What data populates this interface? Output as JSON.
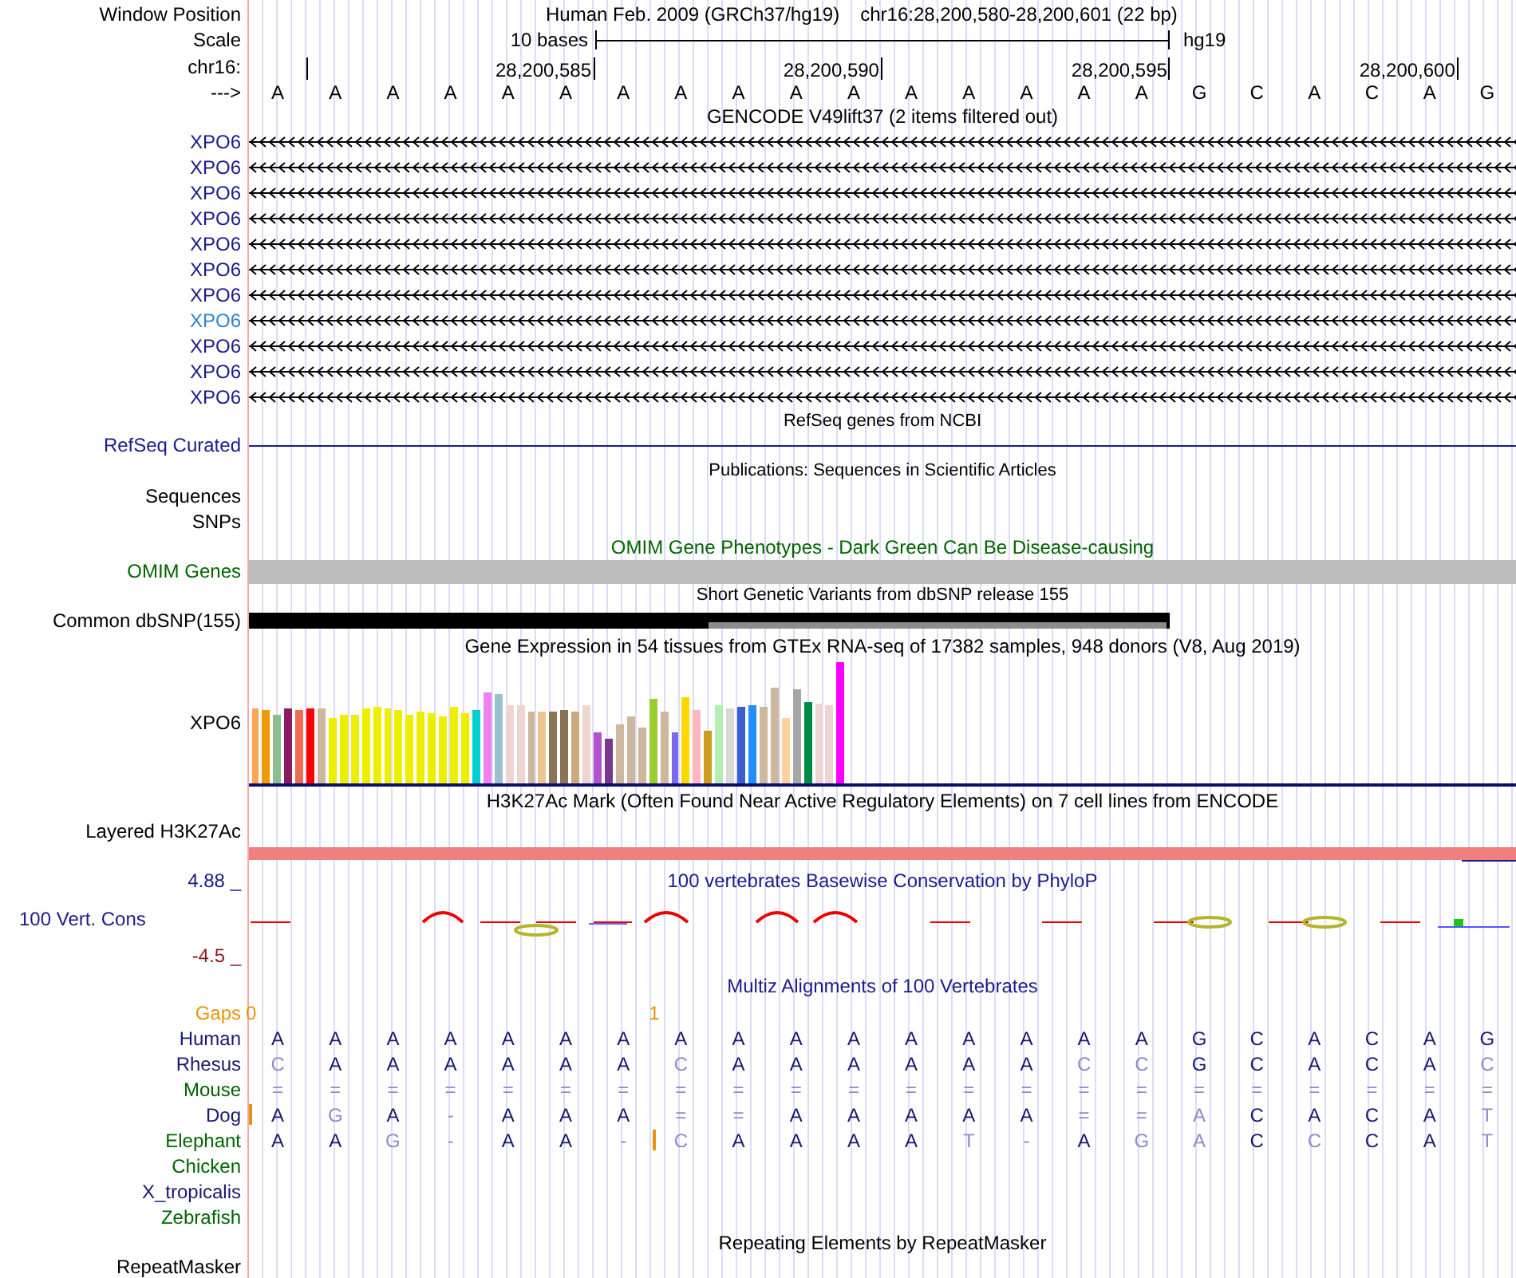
{
  "header": {
    "window_position_label": "Window Position",
    "assembly": "Human Feb. 2009 (GRCh37/hg19)",
    "position": "chr16:28,200,580-28,200,601 (22 bp)",
    "scale_label": "Scale",
    "scale_text": "10 bases",
    "scale_db": "hg19",
    "chrom_label": "chr16:",
    "ticks": [
      "28,200,585",
      "28,200,590",
      "28,200,595",
      "28,200,600"
    ],
    "strand_label": "--->",
    "bases": [
      "A",
      "A",
      "A",
      "A",
      "A",
      "A",
      "A",
      "A",
      "A",
      "A",
      "A",
      "A",
      "A",
      "A",
      "A",
      "A",
      "G",
      "C",
      "A",
      "C",
      "A",
      "G"
    ]
  },
  "tracks": [
    {
      "kind": "gencode",
      "title": "GENCODE V49lift37 (2 items filtered out)",
      "items": [
        {
          "name": "XPO6",
          "selected": false
        },
        {
          "name": "XPO6",
          "selected": false
        },
        {
          "name": "XPO6",
          "selected": false
        },
        {
          "name": "XPO6",
          "selected": false
        },
        {
          "name": "XPO6",
          "selected": false
        },
        {
          "name": "XPO6",
          "selected": false
        },
        {
          "name": "XPO6",
          "selected": false
        },
        {
          "name": "XPO6",
          "selected": true
        },
        {
          "name": "XPO6",
          "selected": false
        },
        {
          "name": "XPO6",
          "selected": false
        },
        {
          "name": "XPO6",
          "selected": false
        }
      ]
    },
    {
      "kind": "refseq",
      "title": "RefSeq genes from NCBI",
      "label": "RefSeq Curated"
    },
    {
      "kind": "empty",
      "title": "Publications: Sequences in Scientific Articles",
      "labels": [
        "Sequences",
        "SNPs"
      ]
    },
    {
      "kind": "omim",
      "title": "OMIM Gene Phenotypes - Dark Green Can Be Disease-causing",
      "label": "OMIM Genes"
    },
    {
      "kind": "dbsnp",
      "title": "Short Genetic Variants from dbSNP release 155",
      "label": "Common dbSNP(155)"
    },
    {
      "kind": "gtex",
      "title": "Gene Expression in 54 tissues from GTEx RNA-seq of 17382 samples, 948 donors (V8, Aug 2019)",
      "label": "XPO6",
      "bars": [
        {
          "color": "#ffa54f"
        },
        {
          "color": "#ee9a00"
        },
        {
          "color": "#8fbc8f"
        },
        {
          "color": "#8b1c62"
        },
        {
          "color": "#ee6a50"
        },
        {
          "color": "#ff0000"
        },
        {
          "color": "#cdb79e"
        },
        {
          "color": "#eeee00"
        },
        {
          "color": "#eeee00"
        },
        {
          "color": "#eeee00"
        },
        {
          "color": "#eeee00"
        },
        {
          "color": "#eeee00"
        },
        {
          "color": "#eeee00"
        },
        {
          "color": "#eeee00"
        },
        {
          "color": "#eeee00"
        },
        {
          "color": "#eeee00"
        },
        {
          "color": "#eeee00"
        },
        {
          "color": "#eeee00"
        },
        {
          "color": "#eeee00"
        },
        {
          "color": "#eeee00"
        },
        {
          "color": "#00ced1"
        },
        {
          "color": "#ee82ee"
        },
        {
          "color": "#9ac0cd"
        },
        {
          "color": "#eed5d2"
        },
        {
          "color": "#eed5d2"
        },
        {
          "color": "#cdb79e"
        },
        {
          "color": "#eec591"
        },
        {
          "color": "#8b7355"
        },
        {
          "color": "#8b7355"
        },
        {
          "color": "#cdaa7d"
        },
        {
          "color": "#eed5d2"
        },
        {
          "color": "#b452cd"
        },
        {
          "color": "#7a378b"
        },
        {
          "color": "#cdb79e"
        },
        {
          "color": "#cdb79e"
        },
        {
          "color": "#cdb79e"
        },
        {
          "color": "#9acd32"
        },
        {
          "color": "#cdb79e"
        },
        {
          "color": "#7b68ee"
        },
        {
          "color": "#ffd700"
        },
        {
          "color": "#ffb6c1"
        },
        {
          "color": "#cd9b1d"
        },
        {
          "color": "#b4eeb4"
        },
        {
          "color": "#d9d9d9"
        },
        {
          "color": "#3a5fcd"
        },
        {
          "color": "#1e90ff"
        },
        {
          "color": "#cdb79e"
        },
        {
          "color": "#cdb79e"
        },
        {
          "color": "#ffd39b"
        },
        {
          "color": "#a6a6a6"
        },
        {
          "color": "#008b45"
        },
        {
          "color": "#eed5d2"
        },
        {
          "color": "#eed5d2"
        },
        {
          "color": "#ff00ff"
        }
      ]
    },
    {
      "kind": "h3k27ac",
      "title": "H3K27Ac Mark (Often Found Near Active Regulatory Elements) on 7 cell lines from ENCODE",
      "label": "Layered H3K27Ac"
    },
    {
      "kind": "phylop",
      "title": "100 vertebrates Basewise Conservation by PhyloP",
      "label": "100 Vert. Cons",
      "axis_max": "4.88 _",
      "axis_min": "-4.5 _"
    },
    {
      "kind": "multiz",
      "title": "Multiz Alignments of 100 Vertebrates",
      "gaps": {
        "label": "Gaps",
        "marks": [
          "0",
          "1"
        ]
      },
      "species": [
        {
          "name": "Human",
          "color": "#191970",
          "bases": [
            {
              "b": "A",
              "match": true
            },
            {
              "b": "A",
              "match": true
            },
            {
              "b": "A",
              "match": true
            },
            {
              "b": "A",
              "match": true
            },
            {
              "b": "A",
              "match": true
            },
            {
              "b": "A",
              "match": true
            },
            {
              "b": "A",
              "match": true
            },
            {
              "b": "A",
              "match": true
            },
            {
              "b": "A",
              "match": true
            },
            {
              "b": "A",
              "match": true
            },
            {
              "b": "A",
              "match": true
            },
            {
              "b": "A",
              "match": true
            },
            {
              "b": "A",
              "match": true
            },
            {
              "b": "A",
              "match": true
            },
            {
              "b": "A",
              "match": true
            },
            {
              "b": "A",
              "match": true
            },
            {
              "b": "G",
              "match": true
            },
            {
              "b": "C",
              "match": true
            },
            {
              "b": "A",
              "match": true
            },
            {
              "b": "C",
              "match": true
            },
            {
              "b": "A",
              "match": true
            },
            {
              "b": "G",
              "match": true
            }
          ]
        },
        {
          "name": "Rhesus",
          "color": "#191970",
          "bases": [
            {
              "b": "C",
              "match": false
            },
            {
              "b": "A",
              "match": true
            },
            {
              "b": "A",
              "match": true
            },
            {
              "b": "A",
              "match": true
            },
            {
              "b": "A",
              "match": true
            },
            {
              "b": "A",
              "match": true
            },
            {
              "b": "A",
              "match": true
            },
            {
              "b": "C",
              "match": false
            },
            {
              "b": "A",
              "match": true
            },
            {
              "b": "A",
              "match": true
            },
            {
              "b": "A",
              "match": true
            },
            {
              "b": "A",
              "match": true
            },
            {
              "b": "A",
              "match": true
            },
            {
              "b": "A",
              "match": true
            },
            {
              "b": "C",
              "match": false
            },
            {
              "b": "C",
              "match": false
            },
            {
              "b": "G",
              "match": true
            },
            {
              "b": "C",
              "match": true
            },
            {
              "b": "A",
              "match": true
            },
            {
              "b": "C",
              "match": true
            },
            {
              "b": "A",
              "match": true
            },
            {
              "b": "C",
              "match": false
            }
          ]
        },
        {
          "name": "Mouse",
          "color": "#006400",
          "bases": [
            {
              "b": "=",
              "match": false
            },
            {
              "b": "=",
              "match": false
            },
            {
              "b": "=",
              "match": false
            },
            {
              "b": "=",
              "match": false
            },
            {
              "b": "=",
              "match": false
            },
            {
              "b": "=",
              "match": false
            },
            {
              "b": "=",
              "match": false
            },
            {
              "b": "=",
              "match": false
            },
            {
              "b": "=",
              "match": false
            },
            {
              "b": "=",
              "match": false
            },
            {
              "b": "=",
              "match": false
            },
            {
              "b": "=",
              "match": false
            },
            {
              "b": "=",
              "match": false
            },
            {
              "b": "=",
              "match": false
            },
            {
              "b": "=",
              "match": false
            },
            {
              "b": "=",
              "match": false
            },
            {
              "b": "=",
              "match": false
            },
            {
              "b": "=",
              "match": false
            },
            {
              "b": "=",
              "match": false
            },
            {
              "b": "=",
              "match": false
            },
            {
              "b": "=",
              "match": false
            },
            {
              "b": "=",
              "match": false
            }
          ]
        },
        {
          "name": "Dog",
          "color": "#191970",
          "bases": [
            {
              "b": "A",
              "match": true,
              "insertion": true
            },
            {
              "b": "G",
              "match": false,
              "insertion": false
            },
            {
              "b": "A",
              "match": true,
              "insertion": false
            },
            {
              "b": "-",
              "match": false,
              "insertion": false
            },
            {
              "b": "A",
              "match": true,
              "insertion": false
            },
            {
              "b": "A",
              "match": true,
              "insertion": false
            },
            {
              "b": "A",
              "match": true,
              "insertion": false
            },
            {
              "b": "=",
              "match": false,
              "insertion": false
            },
            {
              "b": "=",
              "match": false,
              "insertion": false
            },
            {
              "b": "A",
              "match": true,
              "insertion": false
            },
            {
              "b": "A",
              "match": true,
              "insertion": false
            },
            {
              "b": "A",
              "match": true,
              "insertion": false
            },
            {
              "b": "A",
              "match": true,
              "insertion": false
            },
            {
              "b": "A",
              "match": true,
              "insertion": false
            },
            {
              "b": "=",
              "match": false,
              "insertion": false
            },
            {
              "b": "=",
              "match": false,
              "insertion": false
            },
            {
              "b": "A",
              "match": false,
              "insertion": false
            },
            {
              "b": "C",
              "match": true,
              "insertion": false
            },
            {
              "b": "A",
              "match": true,
              "insertion": false
            },
            {
              "b": "C",
              "match": true,
              "insertion": false
            },
            {
              "b": "A",
              "match": true,
              "insertion": false
            },
            {
              "b": "T",
              "match": false,
              "insertion": false
            }
          ]
        },
        {
          "name": "Elephant",
          "color": "#006400",
          "bases": [
            {
              "b": "A",
              "match": true,
              "insertion": false
            },
            {
              "b": "A",
              "match": true,
              "insertion": false
            },
            {
              "b": "G",
              "match": false,
              "insertion": false
            },
            {
              "b": "-",
              "match": false,
              "insertion": false
            },
            {
              "b": "A",
              "match": true,
              "insertion": false
            },
            {
              "b": "A",
              "match": true,
              "insertion": false
            },
            {
              "b": "-",
              "match": false,
              "insertion": false
            },
            {
              "b": "C",
              "match": false,
              "insertion": true
            },
            {
              "b": "A",
              "match": true,
              "insertion": false
            },
            {
              "b": "A",
              "match": true,
              "insertion": false
            },
            {
              "b": "A",
              "match": true,
              "insertion": false
            },
            {
              "b": "A",
              "match": true,
              "insertion": false
            },
            {
              "b": "T",
              "match": false,
              "insertion": false
            },
            {
              "b": "-",
              "match": false,
              "insertion": false
            },
            {
              "b": "A",
              "match": true,
              "insertion": false
            },
            {
              "b": "G",
              "match": false,
              "insertion": false
            },
            {
              "b": "A",
              "match": false,
              "insertion": false
            },
            {
              "b": "C",
              "match": true,
              "insertion": false
            },
            {
              "b": "C",
              "match": false,
              "insertion": false
            },
            {
              "b": "C",
              "match": true,
              "insertion": false
            },
            {
              "b": "A",
              "match": true,
              "insertion": false
            },
            {
              "b": "T",
              "match": false,
              "insertion": false
            }
          ]
        },
        {
          "name": "Chicken",
          "color": "#006400"
        },
        {
          "name": "X_tropicalis",
          "color": "#191970"
        },
        {
          "name": "Zebrafish",
          "color": "#006400"
        }
      ]
    },
    {
      "kind": "repeatmasker",
      "title": "Repeating Elements by RepeatMasker",
      "label": "RepeatMasker"
    }
  ]
}
